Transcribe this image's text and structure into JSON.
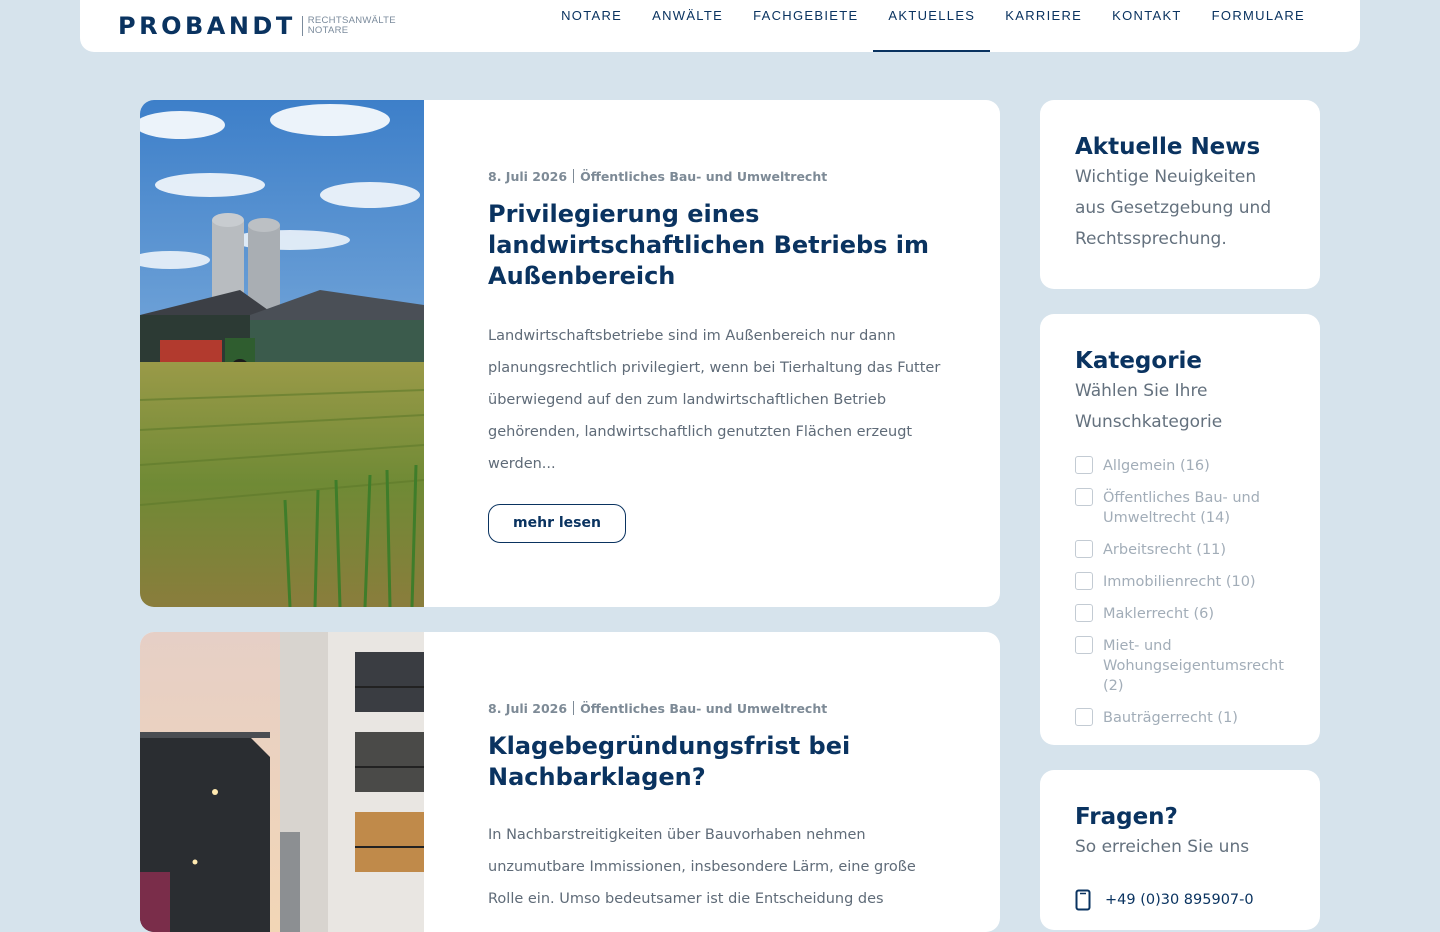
{
  "header": {
    "logo": {
      "word": "PROBANDT",
      "line1": "RECHTSANWÄLTE",
      "line2": "NOTARE"
    },
    "nav": [
      {
        "label": "NOTARE",
        "active": false
      },
      {
        "label": "ANWÄLTE",
        "active": false
      },
      {
        "label": "FACHGEBIETE",
        "active": false
      },
      {
        "label": "AKTUELLES",
        "active": true
      },
      {
        "label": "KARRIERE",
        "active": false
      },
      {
        "label": "KONTAKT",
        "active": false
      },
      {
        "label": "FORMULARE",
        "active": false
      }
    ]
  },
  "posts": [
    {
      "date": "8. Juli 2026",
      "category": "Öffentliches Bau- und Umweltrecht",
      "title": "Privilegierung eines landwirtschaftlichen Betriebs im Außenbereich",
      "excerpt": "Landwirtschaftsbetriebe sind im Außenbereich nur dann planungsrechtlich privilegiert, wenn bei Tierhaltung das Futter überwiegend auf den zum landwirtschaftlichen Betrieb gehörenden, landwirtschaftlich genutzten Flächen erzeugt werden...",
      "button": "mehr lesen"
    },
    {
      "date": "8. Juli 2026",
      "category": "Öffentliches Bau- und Umweltrecht",
      "title": "Klagebegründungsfrist bei Nachbarklagen?",
      "excerpt": "In Nachbarstreitigkeiten über Bauvorhaben nehmen unzumutbare Immissionen, insbesondere Lärm, eine große Rolle ein. Umso bedeutsamer ist die Entscheidung des"
    }
  ],
  "sidebar": {
    "news": {
      "title": "Aktuelle News",
      "subtitle": "Wichtige Neuigkeiten aus Gesetzgebung und Rechtssprechung."
    },
    "categories": {
      "title": "Kategorie",
      "subtitle": "Wählen Sie Ihre Wunschkategorie",
      "items": [
        {
          "label": "Allgemein (16)"
        },
        {
          "label": "Öffentliches Bau- und Umweltrecht (14)"
        },
        {
          "label": "Arbeitsrecht (11)"
        },
        {
          "label": "Immobilienrecht (10)"
        },
        {
          "label": "Maklerrecht (6)"
        },
        {
          "label": "Miet- und Wohungseigentumsrecht (2)"
        },
        {
          "label": "Bauträgerrecht (1)"
        }
      ]
    },
    "contact": {
      "title": "Fragen?",
      "subtitle": "So erreichen Sie uns",
      "phone": "+49 (0)30 895907-0",
      "phone_icon": "phone-icon"
    }
  },
  "colors": {
    "navy": "#0a3360",
    "background": "#d6e3ec",
    "muted": "#7d8a96"
  }
}
